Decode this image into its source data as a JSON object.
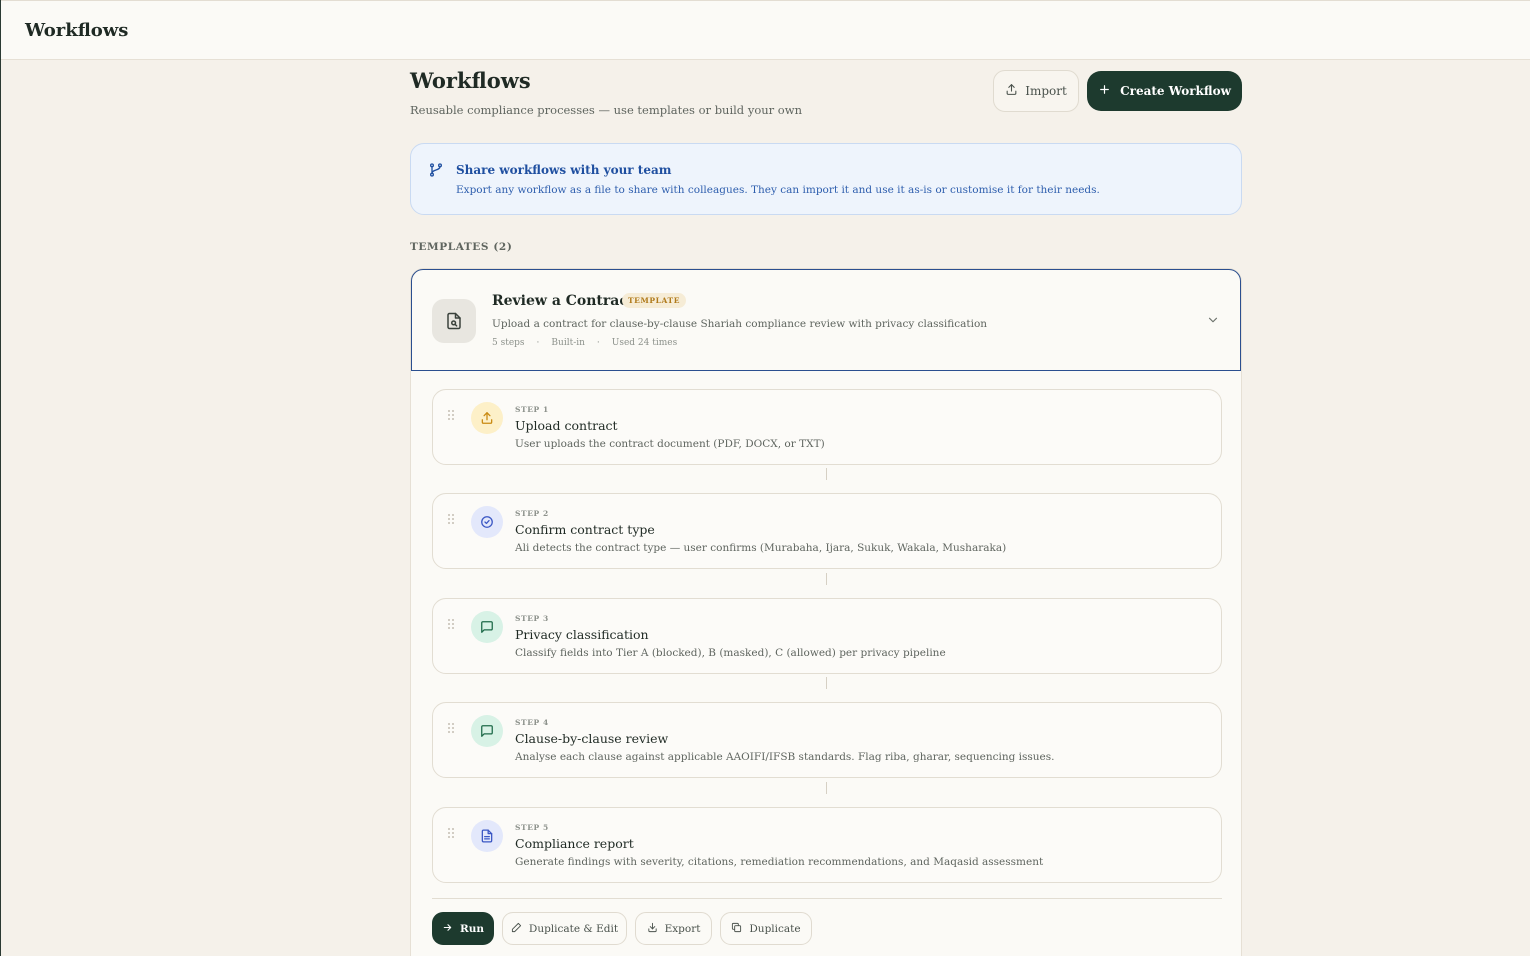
{
  "topbar": {
    "title": "Workflows"
  },
  "header": {
    "title": "Workflows",
    "subtitle": "Reusable compliance processes — use templates or build your own",
    "import_label": "Import",
    "create_label": "Create Workflow"
  },
  "banner": {
    "title": "Share workflows with your team",
    "description": "Export any workflow as a file to share with colleagues. They can import it and use it as-is or customise it for their needs."
  },
  "templates": {
    "label": "TEMPLATES (2)",
    "items": [
      {
        "name": "Review a Contract",
        "badge": "TEMPLATE",
        "description": "Upload a contract for clause-by-clause Shariah compliance review with privacy classification",
        "meta": {
          "steps": "5 steps",
          "source": "Built-in",
          "usage": "Used 24 times"
        },
        "steps": [
          {
            "number": "STEP 1",
            "title": "Upload contract",
            "description": "User uploads the contract document (PDF, DOCX, or TXT)",
            "icon": "upload-icon",
            "color": "#c98a12"
          },
          {
            "number": "STEP 2",
            "title": "Confirm contract type",
            "description": "Ali detects the contract type — user confirms (Murabaha, Ijara, Sukuk, Wakala, Musharaka)",
            "icon": "check-circle-icon",
            "color": "#3b57c4"
          },
          {
            "number": "STEP 3",
            "title": "Privacy classification",
            "description": "Classify fields into Tier A (blocked), B (masked), C (allowed) per privacy pipeline",
            "icon": "message-icon",
            "color": "#1f6b4a"
          },
          {
            "number": "STEP 4",
            "title": "Clause-by-clause review",
            "description": "Analyse each clause against applicable AAOIFI/IFSB standards. Flag riba, gharar, sequencing issues.",
            "icon": "message-icon",
            "color": "#1f6b4a"
          },
          {
            "number": "STEP 5",
            "title": "Compliance report",
            "description": "Generate findings with severity, citations, remediation recommendations, and Maqasid assessment",
            "icon": "document-icon",
            "color": "#3b57c4"
          }
        ],
        "actions": {
          "run": "Run",
          "duplicate_edit": "Duplicate & Edit",
          "export": "Export",
          "duplicate": "Duplicate"
        }
      }
    ]
  }
}
